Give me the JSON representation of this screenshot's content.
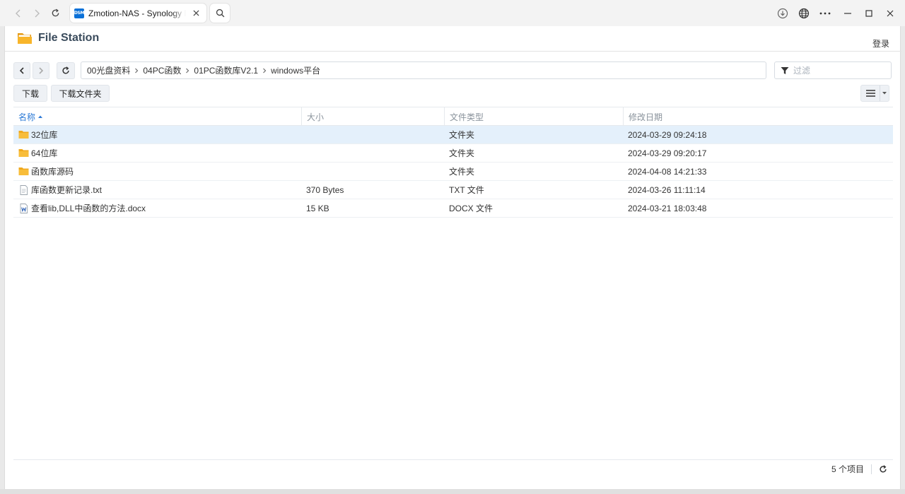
{
  "browser": {
    "tab_title": "Zmotion-NAS - Synology NAS",
    "favicon_text": "DSM"
  },
  "app": {
    "title": "File Station",
    "login_label": "登录"
  },
  "breadcrumb": {
    "items": [
      "00光盘资料",
      "04PC函数",
      "01PC函数库V2.1",
      "windows平台"
    ]
  },
  "filter": {
    "placeholder": "过滤"
  },
  "actions": {
    "download_label": "下载",
    "download_folder_label": "下载文件夹"
  },
  "table": {
    "headers": {
      "name": "名称",
      "size": "大小",
      "type": "文件类型",
      "modified": "修改日期"
    },
    "rows": [
      {
        "icon": "folder-icon",
        "name": "32位库",
        "size": "",
        "type": "文件夹",
        "modified": "2024-03-29 09:24:18"
      },
      {
        "icon": "folder-icon",
        "name": "64位库",
        "size": "",
        "type": "文件夹",
        "modified": "2024-03-29 09:20:17"
      },
      {
        "icon": "folder-icon",
        "name": "函数库源码",
        "size": "",
        "type": "文件夹",
        "modified": "2024-04-08 14:21:33"
      },
      {
        "icon": "text-file-icon",
        "name": "库函数更新记录.txt",
        "size": "370 Bytes",
        "type": "TXT 文件",
        "modified": "2024-03-26 11:11:14"
      },
      {
        "icon": "word-file-icon",
        "name": "查看lib,DLL中函数的方法.docx",
        "size": "15 KB",
        "type": "DOCX 文件",
        "modified": "2024-03-21 18:03:48"
      }
    ]
  },
  "footer": {
    "item_count": "5 个项目"
  },
  "colors": {
    "accent": "#2d7ad6",
    "selected_row": "#e4f0fb",
    "folder": "#f7b52b",
    "favicon": "#0b71d8"
  }
}
